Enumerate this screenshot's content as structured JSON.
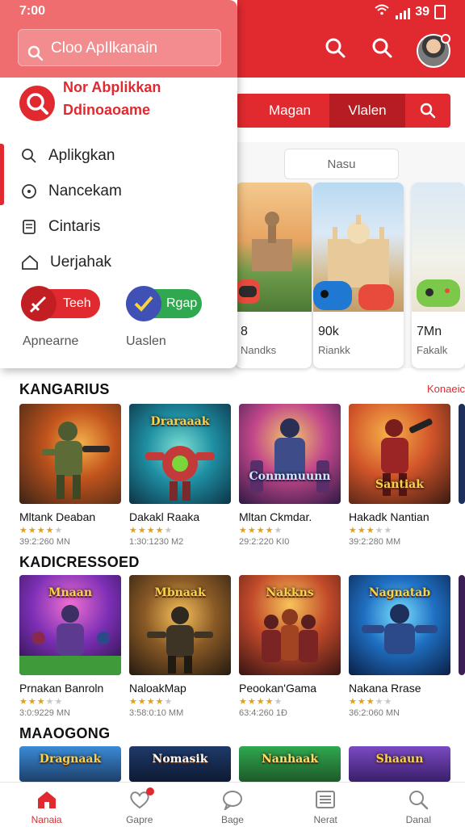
{
  "status": {
    "time": "7:00",
    "network": "39"
  },
  "drawer": {
    "search_placeholder": "Cloo ApIlkanain",
    "brand_line1": "Nor Abplikkan",
    "brand_line2": "Ddinoaoame",
    "menu": [
      {
        "label": "Aplikgkan",
        "icon": "search-icon"
      },
      {
        "label": "Nancekam",
        "icon": "compass-icon"
      },
      {
        "label": "Cintaris",
        "icon": "document-icon"
      },
      {
        "label": "Uerjahak",
        "icon": "home-icon"
      }
    ],
    "pill_left": {
      "label": "Teeh",
      "caption": "Apnearne",
      "color": "#e02a2f"
    },
    "pill_right": {
      "label": "Rgap",
      "caption": "Uaslen",
      "color": "#2fa84f"
    }
  },
  "filter_chips": [
    "Magan",
    "Vlalen"
  ],
  "featured": {
    "pill": "Nasu",
    "cards": [
      {
        "value": "8",
        "label": "Nandks"
      },
      {
        "value": "90k",
        "label": "Riankk"
      },
      {
        "value": "7Mn",
        "label": "Fakalk"
      }
    ]
  },
  "sections": [
    {
      "title": "KANGARIUS",
      "see_more": "Konaeic",
      "games": [
        {
          "name": "Mltank Deaban",
          "meta": "39:2:260 MN",
          "logo": "",
          "rating": 4
        },
        {
          "name": "Dakakl Raaka",
          "meta": "1:30:1230 M2",
          "logo": "Draraaak",
          "rating": 4
        },
        {
          "name": "Mltan Ckmdar.",
          "meta": "29:2:220 KI0",
          "logo": "Conmmuunn",
          "rating": 4
        },
        {
          "name": "Hakadk Nantian",
          "meta": "39:2:280 MM",
          "logo": "Santiak",
          "rating": 3
        }
      ]
    },
    {
      "title": "KADICRESSOED",
      "games": [
        {
          "name": "Prnakan Banroln",
          "meta": "3:0:9229 MN",
          "logo": "Mnaan",
          "rating": 3
        },
        {
          "name": "NaloakMap",
          "meta": "3:58:0:10 MM",
          "logo": "Mbnaak",
          "rating": 4
        },
        {
          "name": "Peookan'Gama",
          "meta": "63:4:260 1Ð",
          "logo": "Nakkns",
          "rating": 4
        },
        {
          "name": "Nakana Rrase",
          "meta": "36:2:060 MN",
          "logo": "Nagnatab",
          "rating": 3
        }
      ]
    },
    {
      "title": "MAAOGONG",
      "games": [
        {
          "logo": "Dragnaak"
        },
        {
          "logo": "Nomasik"
        },
        {
          "logo": "Nanhaak"
        },
        {
          "logo": "Shaaun"
        }
      ]
    }
  ],
  "bottom_nav": [
    {
      "label": "Nanaia",
      "icon": "home-icon",
      "active": true
    },
    {
      "label": "Gapre",
      "icon": "heart-icon",
      "active": false
    },
    {
      "label": "Bage",
      "icon": "chat-icon",
      "active": false
    },
    {
      "label": "Nerat",
      "icon": "list-icon",
      "active": false
    },
    {
      "label": "Danal",
      "icon": "search-icon",
      "active": false
    }
  ],
  "colors": {
    "accent": "#e02a2f",
    "accent_dark": "#b51d22",
    "drawer_head": "#ef6c6f"
  }
}
